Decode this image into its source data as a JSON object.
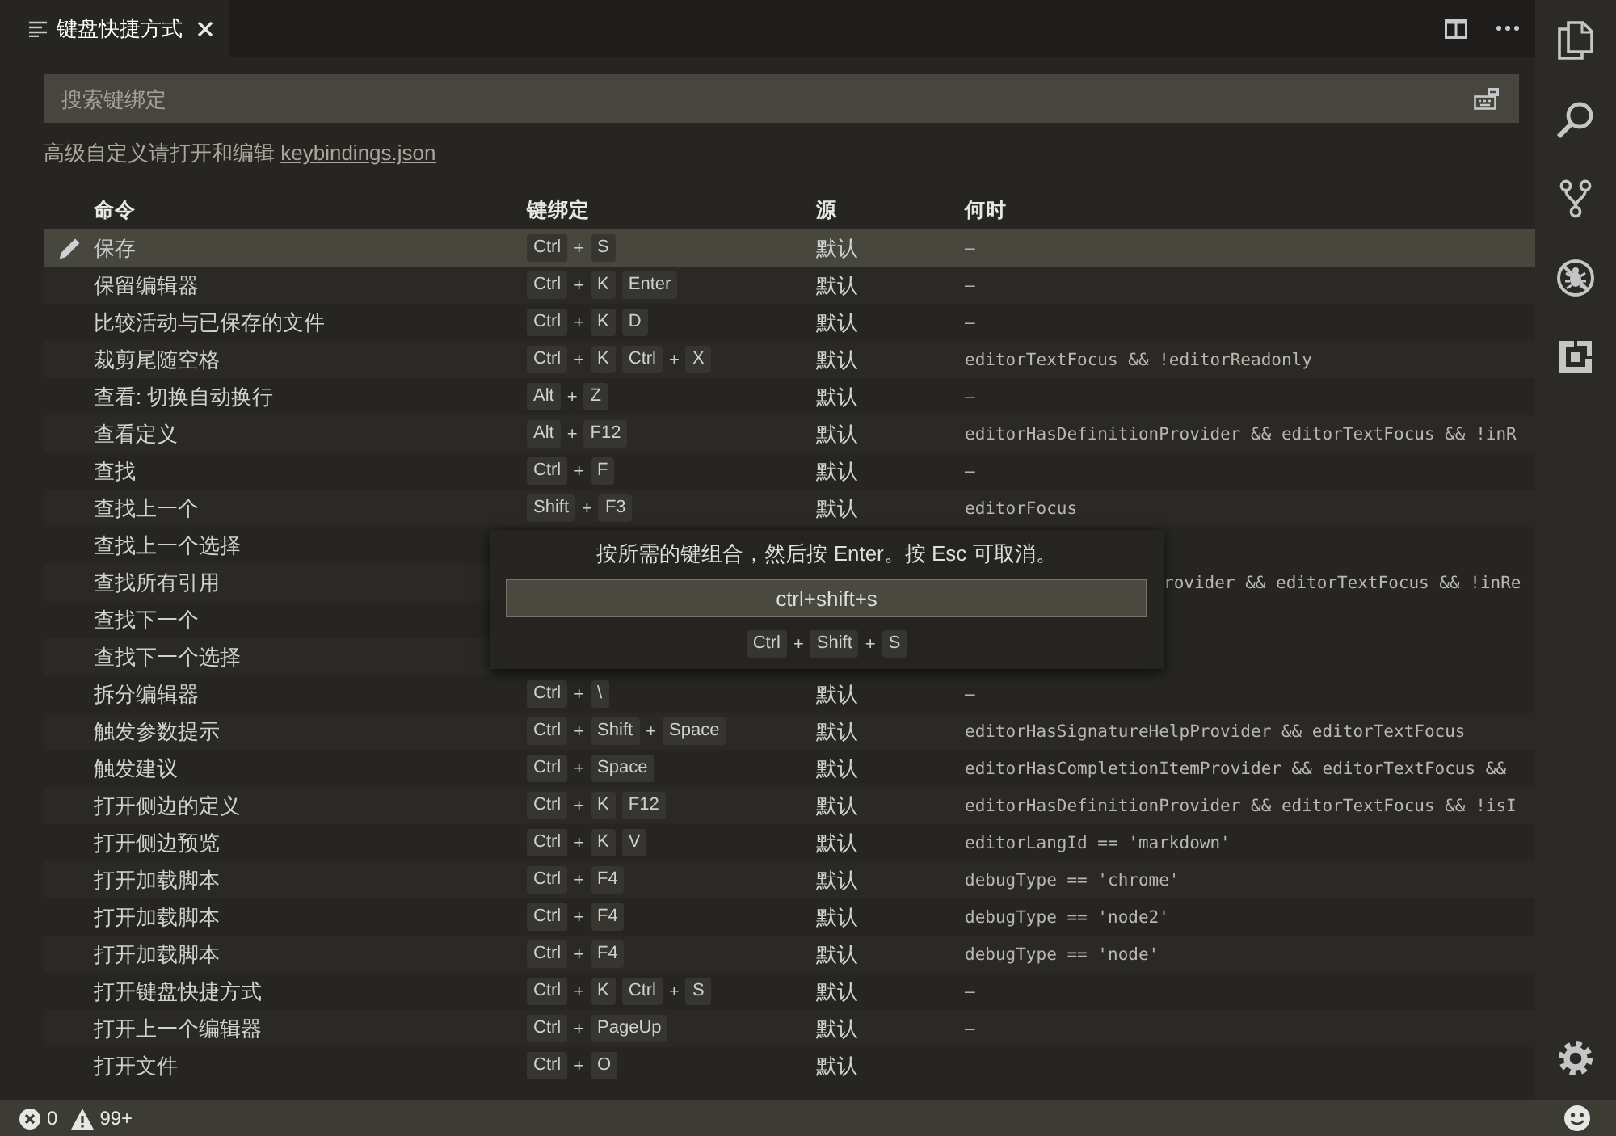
{
  "tab": {
    "title": "键盘快捷方式",
    "selected": true
  },
  "search": {
    "placeholder": "搜索键绑定"
  },
  "hint": {
    "text": "高级自定义请打开和编辑",
    "link": "keybindings.json"
  },
  "table": {
    "columns": [
      "命令",
      "键绑定",
      "源",
      "何时"
    ],
    "rows": [
      {
        "selected": true,
        "command": "保存",
        "keys": [
          [
            "Ctrl",
            "+",
            "S"
          ]
        ],
        "source": "默认",
        "when": "—"
      },
      {
        "selected": false,
        "command": "保留编辑器",
        "keys": [
          [
            "Ctrl",
            "+",
            "K"
          ],
          [
            "Enter"
          ]
        ],
        "source": "默认",
        "when": "—"
      },
      {
        "selected": false,
        "command": "比较活动与已保存的文件",
        "keys": [
          [
            "Ctrl",
            "+",
            "K"
          ],
          [
            "D"
          ]
        ],
        "source": "默认",
        "when": "—"
      },
      {
        "selected": false,
        "command": "裁剪尾随空格",
        "keys": [
          [
            "Ctrl",
            "+",
            "K"
          ],
          [
            "Ctrl",
            "+",
            "X"
          ]
        ],
        "source": "默认",
        "when": "editorTextFocus && !editorReadonly"
      },
      {
        "selected": false,
        "command": "查看: 切换自动换行",
        "keys": [
          [
            "Alt",
            "+",
            "Z"
          ]
        ],
        "source": "默认",
        "when": "—"
      },
      {
        "selected": false,
        "command": "查看定义",
        "keys": [
          [
            "Alt",
            "+",
            "F12"
          ]
        ],
        "source": "默认",
        "when": "editorHasDefinitionProvider && editorTextFocus && !inR"
      },
      {
        "selected": false,
        "command": "查找",
        "keys": [
          [
            "Ctrl",
            "+",
            "F"
          ]
        ],
        "source": "默认",
        "when": "—"
      },
      {
        "selected": false,
        "command": "查找上一个",
        "keys": [
          [
            "Shift",
            "+",
            "F3"
          ]
        ],
        "source": "默认",
        "when": "editorFocus"
      },
      {
        "selected": false,
        "command": "查找上一个选择",
        "under_dialog": true
      },
      {
        "selected": false,
        "command": "查找所有引用",
        "when": "rovider && editorTextFocus && !inRe",
        "under_dialog": true
      },
      {
        "selected": false,
        "command": "查找下一个",
        "under_dialog": true
      },
      {
        "selected": false,
        "command": "查找下一个选择",
        "under_dialog": true
      },
      {
        "selected": false,
        "command": "拆分编辑器",
        "keys": [
          [
            "Ctrl",
            "+",
            "\\"
          ]
        ],
        "source": "默认",
        "when": "—"
      },
      {
        "selected": false,
        "command": "触发参数提示",
        "keys": [
          [
            "Ctrl",
            "+",
            "Shift",
            "+",
            "Space"
          ]
        ],
        "source": "默认",
        "when": "editorHasSignatureHelpProvider && editorTextFocus"
      },
      {
        "selected": false,
        "command": "触发建议",
        "keys": [
          [
            "Ctrl",
            "+",
            "Space"
          ]
        ],
        "source": "默认",
        "when": "editorHasCompletionItemProvider && editorTextFocus &&"
      },
      {
        "selected": false,
        "command": "打开侧边的定义",
        "keys": [
          [
            "Ctrl",
            "+",
            "K"
          ],
          [
            "F12"
          ]
        ],
        "source": "默认",
        "when": "editorHasDefinitionProvider && editorTextFocus && !isI"
      },
      {
        "selected": false,
        "command": "打开侧边预览",
        "keys": [
          [
            "Ctrl",
            "+",
            "K"
          ],
          [
            "V"
          ]
        ],
        "source": "默认",
        "when": "editorLangId == 'markdown'"
      },
      {
        "selected": false,
        "command": "打开加载脚本",
        "keys": [
          [
            "Ctrl",
            "+",
            "F4"
          ]
        ],
        "source": "默认",
        "when": "debugType == 'chrome'"
      },
      {
        "selected": false,
        "command": "打开加载脚本",
        "keys": [
          [
            "Ctrl",
            "+",
            "F4"
          ]
        ],
        "source": "默认",
        "when": "debugType == 'node2'"
      },
      {
        "selected": false,
        "command": "打开加载脚本",
        "keys": [
          [
            "Ctrl",
            "+",
            "F4"
          ]
        ],
        "source": "默认",
        "when": "debugType == 'node'"
      },
      {
        "selected": false,
        "command": "打开键盘快捷方式",
        "keys": [
          [
            "Ctrl",
            "+",
            "K"
          ],
          [
            "Ctrl",
            "+",
            "S"
          ]
        ],
        "source": "默认",
        "when": "—"
      },
      {
        "selected": false,
        "command": "打开上一个编辑器",
        "keys": [
          [
            "Ctrl",
            "+",
            "PageUp"
          ]
        ],
        "source": "默认",
        "when": "—"
      },
      {
        "selected": false,
        "command": "打开文件",
        "keys": [
          [
            "Ctrl",
            "+",
            "O"
          ]
        ],
        "source": "默认"
      }
    ]
  },
  "dialog": {
    "prompt": "按所需的键组合，然后按 Enter。按 Esc 可取消。",
    "value": "ctrl+shift+s",
    "keys": [
      [
        "Ctrl",
        "+",
        "Shift",
        "+",
        "S"
      ]
    ]
  },
  "status_bar": {
    "errors": "0",
    "warnings": "99+"
  }
}
